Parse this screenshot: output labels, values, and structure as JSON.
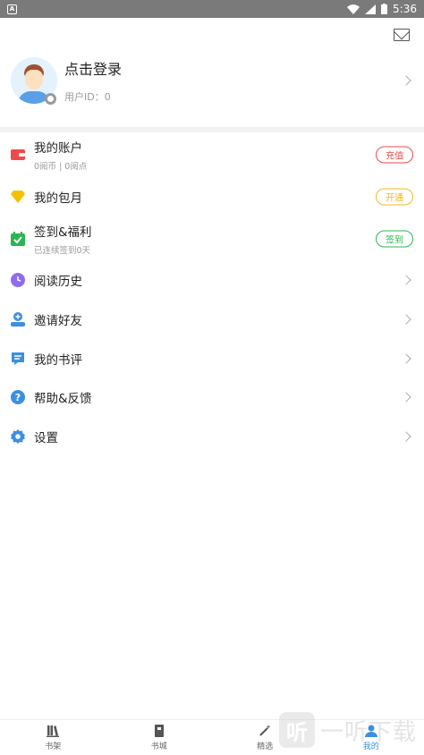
{
  "status_bar": {
    "time": "5:36",
    "app_icon": "A"
  },
  "header": {
    "mail_icon": "mail-icon"
  },
  "profile": {
    "login_label": "点击登录",
    "user_id_label": "用户ID：0"
  },
  "menu": [
    {
      "id": "account",
      "label": "我的账户",
      "sub": "0阅币 | 0阅点",
      "action": "充值",
      "action_color": "#ef4a4a",
      "icon": "wallet-icon",
      "icon_color": "#ef4a4a"
    },
    {
      "id": "monthly",
      "label": "我的包月",
      "action": "开通",
      "action_color": "#f2b824",
      "icon": "diamond-icon",
      "icon_color": "#f2c200"
    },
    {
      "id": "checkin",
      "label": "签到&福利",
      "sub": "已连续签到0天",
      "action": "签到",
      "action_color": "#2bb552",
      "icon": "calendar-check-icon",
      "icon_color": "#2bb552"
    },
    {
      "id": "history",
      "label": "阅读历史",
      "icon": "clock-icon",
      "icon_color": "#8f6bf0"
    },
    {
      "id": "invite",
      "label": "邀请好友",
      "icon": "add-user-icon",
      "icon_color": "#3d8fe0"
    },
    {
      "id": "reviews",
      "label": "我的书评",
      "icon": "comment-icon",
      "icon_color": "#3d8fe0"
    },
    {
      "id": "help",
      "label": "帮助&反馈",
      "icon": "help-icon",
      "icon_color": "#3d8fe0"
    },
    {
      "id": "settings",
      "label": "设置",
      "icon": "gear-icon",
      "icon_color": "#3d8fe0"
    }
  ],
  "tabs": [
    {
      "label": "书架",
      "icon": "bookshelf-icon"
    },
    {
      "label": "书城",
      "icon": "bookstore-icon"
    },
    {
      "label": "精选",
      "icon": "magic-wand-icon"
    },
    {
      "label": "我的",
      "icon": "user-icon",
      "active": true
    }
  ],
  "watermark": {
    "glyph": "听",
    "text": "一听下载"
  },
  "colors": {
    "accent": "#3d8fe0"
  }
}
